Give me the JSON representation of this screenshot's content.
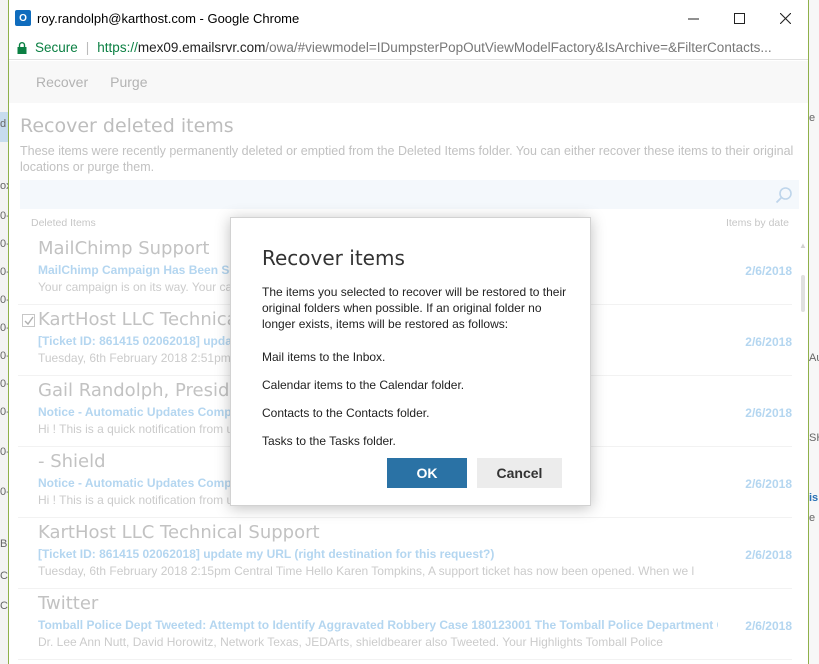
{
  "background": {
    "left_ticks": [
      "d",
      "ox",
      "0-",
      "0-",
      "0-",
      "0-",
      "0-",
      "0-",
      "0-",
      "0-",
      "0-",
      "0-",
      "Bi",
      "Ca",
      "Ch"
    ],
    "right_ticks": [
      "e",
      "Au",
      "SH",
      "is",
      "e"
    ]
  },
  "window": {
    "title": "roy.randolph@karthost.com - Google Chrome",
    "app_icon_text": "O",
    "controls": [
      "minimize-icon",
      "maximize-icon",
      "close-icon"
    ]
  },
  "address": {
    "secure_label": "Secure",
    "url_scheme": "https://",
    "url_host": "mex09.emailsrvr.com",
    "url_rest": "/owa/#viewmodel=IDumpsterPopOutViewModelFactory&IsArchive=&FilterContacts..."
  },
  "toolbar": {
    "recover_label": "Recover",
    "purge_label": "Purge"
  },
  "page": {
    "title": "Recover deleted items",
    "description": "These items were recently permanently deleted or emptied from the Deleted Items folder. You can either recover these items to their original locations or purge them."
  },
  "columns": {
    "left": "Deleted Items",
    "right": "Items by date"
  },
  "items": [
    {
      "sender": "MailChimp Support",
      "subject": "MailChimp Campaign Has Been Sent",
      "preview": "Your campaign is on its way.  Your campaign                                                                                   es Coming Soon to",
      "date": "2/6/2018",
      "checked": false
    },
    {
      "sender": "KartHost LLC Technical Support",
      "subject": "[Ticket ID: 861415 02062018] update my URL (right destination for this request?)",
      "preview": "Tuesday, 6th February 2018 2:51pm                                                                                             ION Login to your",
      "date": "2/6/2018",
      "checked": true
    },
    {
      "sender": "Gail Randolph, President",
      "subject": "Notice - Automatic Updates Complete",
      "preview": "Hi !  This is a quick notification from                                                                                        ur site with the follo",
      "date": "2/6/2018",
      "checked": false
    },
    {
      "sender": "- Shield",
      "subject": "Notice - Automatic Updates Complete",
      "preview": "Hi !  This is a quick notification from                                                                                        ur site with the follo",
      "date": "2/6/2018",
      "checked": false
    },
    {
      "sender": "KartHost LLC Technical Support",
      "subject": "[Ticket ID: 861415 02062018] update my URL (right destination for this request?)",
      "preview": "Tuesday, 6th February 2018 2:15pm Central Time  Hello Karen Tompkins,  A support ticket has now been opened.  When we l",
      "date": "2/6/2018",
      "checked": false
    },
    {
      "sender": "Twitter",
      "subject": "Tomball Police Dept Tweeted: Attempt to Identify Aggravated Robbery Case 180123001 The Tomball Police Department C",
      "preview": "Dr. Lee Ann Nutt, David Horowitz, Network Texas, JEDArts, shieldbearer also Tweeted.       Your Highlights      Tomball Police",
      "date": "2/6/2018",
      "checked": false
    }
  ],
  "dialog": {
    "title": "Recover items",
    "body": "The items you selected to recover will be restored to their original folders when possible. If an original folder no longer exists, items will be restored as follows:",
    "lines": [
      "Mail items to the Inbox.",
      "Calendar items to the Calendar folder.",
      "Contacts to the Contacts folder.",
      "Tasks to the Tasks folder."
    ],
    "ok_label": "OK",
    "cancel_label": "Cancel"
  },
  "colors": {
    "accent": "#2a72a5",
    "secure_green": "#0b8043",
    "link_blue": "#8cc0e9"
  }
}
